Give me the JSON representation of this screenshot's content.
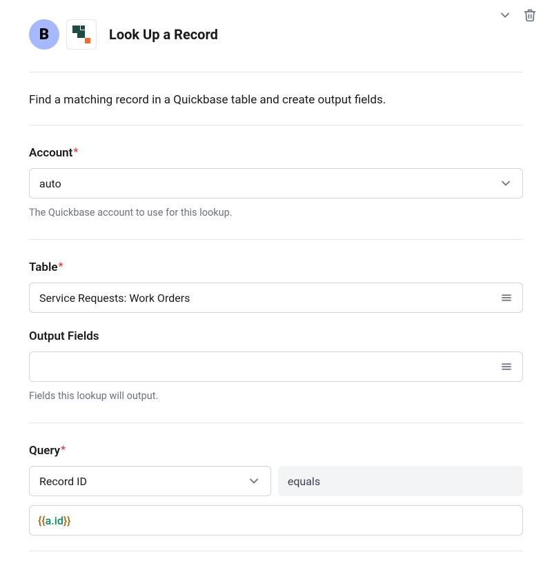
{
  "header": {
    "badge_letter": "B",
    "title": "Look Up a Record"
  },
  "description": "Find a matching record in a Quickbase table and create output fields.",
  "fields": {
    "account": {
      "label": "Account",
      "required": "*",
      "value": "auto",
      "helper": "The Quickbase account to use for this lookup."
    },
    "table": {
      "label": "Table",
      "required": "*",
      "value": "Service Requests: Work Orders"
    },
    "output_fields": {
      "label": "Output Fields",
      "value": "",
      "helper": "Fields this lookup will output."
    },
    "query": {
      "label": "Query",
      "required": "*",
      "field_value": "Record ID",
      "operator": "equals",
      "token_open": "{{",
      "token_body": "a.id",
      "token_close": "}}"
    }
  }
}
